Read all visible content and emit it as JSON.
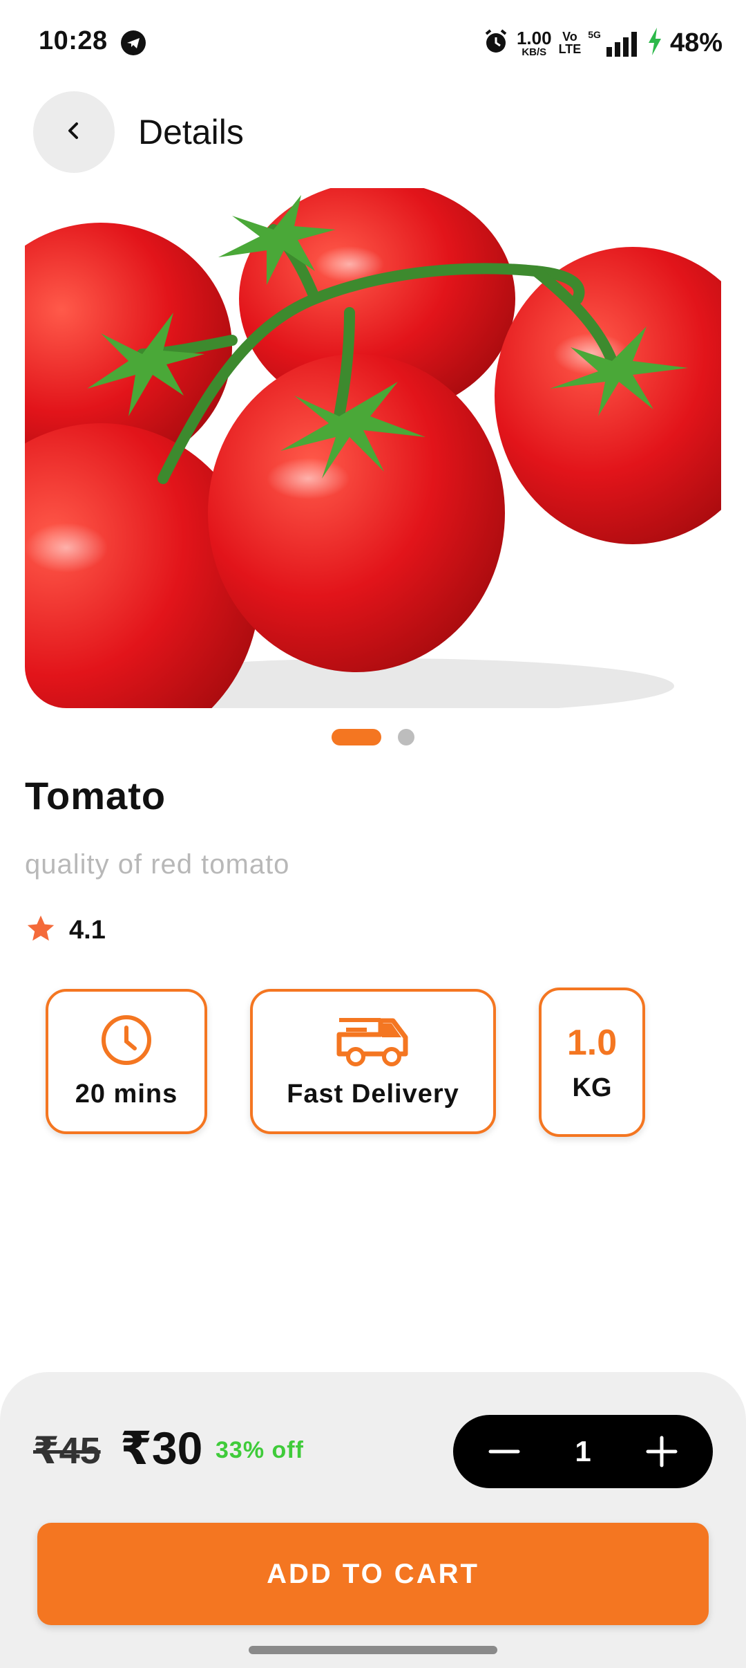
{
  "status_bar": {
    "time": "10:28",
    "speed_value": "1.00",
    "speed_unit": "KB/S",
    "volte_top": "Vo",
    "volte_bottom": "LTE",
    "network": "5G",
    "battery": "48%",
    "icons": [
      "telegram-icon",
      "alarm-icon",
      "signal-icon",
      "charging-icon"
    ]
  },
  "header": {
    "title": "Details",
    "back_icon": "chevron-left-icon"
  },
  "product": {
    "name": "Tomato",
    "description": "quality of red tomato",
    "rating": "4.1",
    "image_pages": 2,
    "active_page": 1
  },
  "features": {
    "time_label": "20 mins",
    "delivery_label": "Fast Delivery",
    "weight_value": "1.0",
    "weight_unit": "KG"
  },
  "pricing": {
    "old_price": "₹45",
    "new_price": "₹30",
    "discount": "33% off",
    "quantity": "1"
  },
  "cart": {
    "button_label": "ADD TO CART"
  },
  "colors": {
    "accent": "#f47621",
    "discount_green": "#3fcb3a",
    "stepper_bg": "#000000",
    "sheet_bg": "#efefef"
  }
}
